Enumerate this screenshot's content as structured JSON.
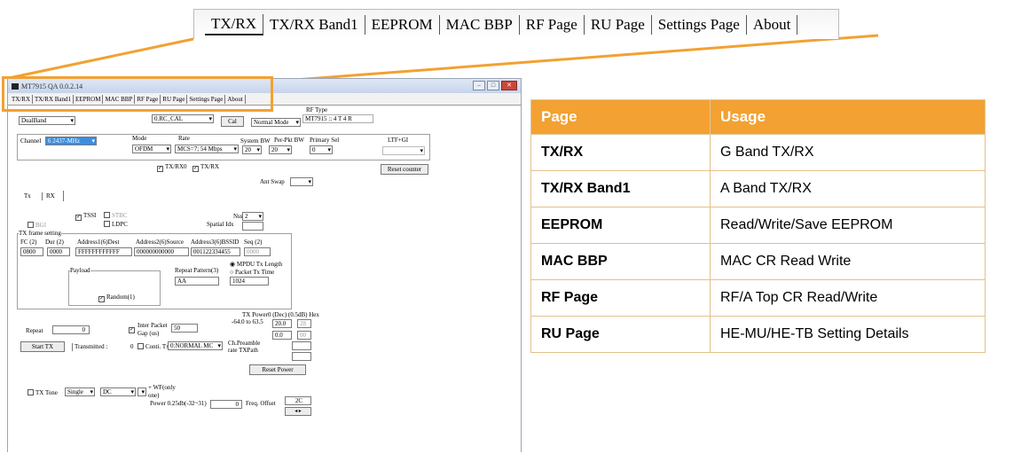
{
  "zoom_tabs": [
    "TX/RX",
    "TX/RX Band1",
    "EEPROM",
    "MAC  BBP",
    "RF Page",
    "RU Page",
    "Settings Page",
    "About"
  ],
  "app": {
    "title": "MT7915 QA 0.0.2.14",
    "tabs": [
      "TX/RX",
      "TX/RX Band1",
      "EEPROM",
      "MAC  BBP",
      "RF Page",
      "RU Page",
      "Settings Page",
      "About"
    ],
    "band_select": "DualBand",
    "cal_select": "0.RC_CAL",
    "cal_button": "Cal",
    "mode_select": "Normal Mode",
    "rf_type_label": "RF Type",
    "rf_type_value": "MT7915 :: 4 T 4 R",
    "channel_label": "Channel",
    "channel_value": "6  2437-MHz",
    "mode_label": "Mode",
    "mode_value": "OFDM",
    "rate_label": "Rate",
    "rate_value": "MCS=7; 54 Mbps",
    "system_bw_label": "System BW",
    "system_bw_value": "20",
    "per_pkt_bw_label": "Per-Pkt BW",
    "per_pkt_bw_value": "20",
    "primary_sel_label": "Primary Sel",
    "primary_sel_value": "0",
    "ltf_label": "LTF+GI",
    "txrx0_label": "TX/RX0",
    "txrx_label": "TX/RX",
    "reset_counter": "Reset counter",
    "ant_swap_label": "Ant Swap",
    "sub_tabs": [
      "Tx",
      "RX"
    ],
    "tssi_label": "TSSI",
    "stbc_label": "STBC",
    "nss_label": "Nss",
    "nss_value": "2",
    "ldpc_label": "LDPC",
    "spatial_idx_label": "Spatial Idx",
    "bgi_label": "BGI",
    "tx_frame_label": "TX frame setting",
    "fc_label": "FC (2)",
    "fc_value": "0800",
    "dur_label": "Dur (2)",
    "dur_value": "0000",
    "addr1_label": "Address1(6)Dest",
    "addr1_value": "FFFFFFFFFFFF",
    "addr2_label": "Address2(6)Source",
    "addr2_value": "000000000000",
    "addr3_label": "Address3(6)BSSID",
    "addr3_value": "001122334455",
    "seq_label": "Seq (2)",
    "seq_value": "0000",
    "payload_label": "Payload",
    "repeat_pattern_label": "Repeat Pattern(3)",
    "repeat_pattern_value": "AA",
    "mpdu_label": "MPDU Tx Length",
    "packet_time_label": "Packet Tx Time",
    "length_value": "1024",
    "random_label": "Random(1)",
    "repeat_label": "Repeat",
    "repeat_value": "0",
    "inter_packet_label": "Inter Packet Gap (us)",
    "inter_packet_value": "50",
    "tx_power_label": "TX Power0 (Dec) (0.5dB) Hex",
    "tx_power_range": "-64.0 to 63.5",
    "power_values": [
      "20.0",
      "0.0"
    ],
    "power_hex": [
      "28",
      "00"
    ],
    "start_tx": "Start TX",
    "transmitted_label": "Transmitted :",
    "transmitted_value": "0",
    "conti_label": "Conti. Tx",
    "conti_value": "0:NORMAL MC",
    "ch_preamble_label": "Ch.Preamble",
    "rate_txpath_label": "rate TXPath",
    "reset_power": "Reset Power",
    "tx_tone_label": "TX Tone",
    "tone_single": "Single",
    "tone_dc": "DC",
    "wf_label": "+ WF(only one)",
    "power_025_label": "Power 0.25db(-32~31)",
    "power_025_value": "0",
    "freq_offset_label": "Freq. Offset",
    "freq_offset_value": "2C"
  },
  "table": {
    "headers": [
      "Page",
      "Usage"
    ],
    "rows": [
      [
        "TX/RX",
        "G Band TX/RX"
      ],
      [
        "TX/RX Band1",
        "A Band TX/RX"
      ],
      [
        "EEPROM",
        "Read/Write/Save EEPROM"
      ],
      [
        "MAC BBP",
        "MAC CR Read Write"
      ],
      [
        "RF Page",
        "RF/A Top CR Read/Write"
      ],
      [
        "RU Page",
        "HE-MU/HE-TB Setting Details"
      ]
    ]
  },
  "colors": {
    "accent": "#f2a132",
    "channel_highlight": "#3b8de0"
  }
}
